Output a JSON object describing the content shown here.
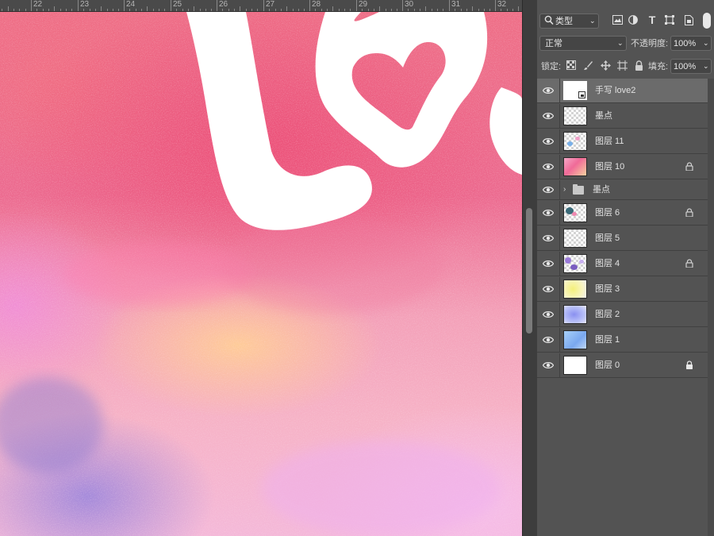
{
  "ruler": {
    "labels": [
      "22",
      "23",
      "24",
      "25",
      "26",
      "27",
      "28",
      "29",
      "30",
      "31",
      "32"
    ]
  },
  "canvas": {
    "artwork_description_colors": {
      "hot_pink": "#ec5c82",
      "peach": "#ffcf9a",
      "lavender": "#b38be0",
      "light_pink": "#f6b8d6",
      "lettering": "#ffffff"
    }
  },
  "layers_panel": {
    "filter": {
      "search_icon": "search-icon",
      "kind_label": "类型",
      "filter_icons": [
        "image-filter-icon",
        "adjustment-filter-icon",
        "type-filter-icon",
        "shape-filter-icon",
        "smart-object-filter-icon"
      ]
    },
    "blend_mode": "正常",
    "opacity_label": "不透明度:",
    "opacity_value": "100%",
    "lock_label": "锁定:",
    "lock_icons": [
      "lock-transparent-icon",
      "lock-image-icon",
      "lock-position-icon",
      "lock-artboard-icon",
      "lock-all-icon"
    ],
    "fill_label": "填充:",
    "fill_value": "100%",
    "layers": [
      {
        "name": "手写 love2",
        "type": "smart",
        "selected": true,
        "locked": false
      },
      {
        "name": "墨点",
        "type": "layer",
        "selected": false,
        "locked": false
      },
      {
        "name": "图层 11",
        "type": "layer",
        "selected": false,
        "locked": false
      },
      {
        "name": "图层 10",
        "type": "layer",
        "selected": false,
        "locked": true
      },
      {
        "name": "墨点",
        "type": "group",
        "selected": false,
        "locked": false
      },
      {
        "name": "图层 6",
        "type": "layer",
        "selected": false,
        "locked": true
      },
      {
        "name": "图层 5",
        "type": "layer",
        "selected": false,
        "locked": false
      },
      {
        "name": "图层 4",
        "type": "layer",
        "selected": false,
        "locked": true
      },
      {
        "name": "图层 3",
        "type": "layer",
        "selected": false,
        "locked": false
      },
      {
        "name": "图层 2",
        "type": "layer",
        "selected": false,
        "locked": false
      },
      {
        "name": "图层 1",
        "type": "layer",
        "selected": false,
        "locked": false
      },
      {
        "name": "图层 0",
        "type": "layer",
        "selected": false,
        "locked": true
      }
    ]
  }
}
